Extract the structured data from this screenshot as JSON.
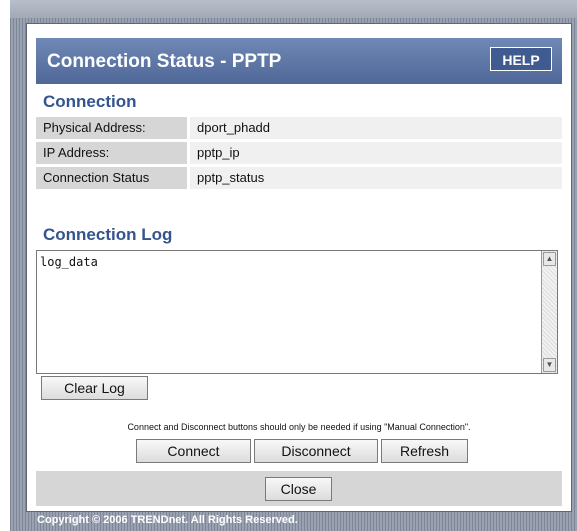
{
  "header": {
    "title": "Connection Status - PPTP",
    "help_label": "HELP"
  },
  "connection": {
    "heading": "Connection",
    "rows": [
      {
        "label": "Physical Address:",
        "value": "dport_phadd"
      },
      {
        "label": "IP Address:",
        "value": "pptp_ip"
      },
      {
        "label": "Connection Status",
        "value": "pptp_status"
      }
    ]
  },
  "log": {
    "heading": "Connection Log",
    "content": "log_data",
    "clear_label": "Clear Log"
  },
  "actions": {
    "note": "Connect and Disconnect buttons should only be needed if using \"Manual Connection\".",
    "connect_label": "Connect",
    "disconnect_label": "Disconnect",
    "refresh_label": "Refresh"
  },
  "footer": {
    "close_label": "Close",
    "copyright": "Copyright © 2006 TRENDnet. All Rights Reserved."
  },
  "icons": {
    "scroll_up": "scroll-up-arrow-icon",
    "scroll_down": "scroll-down-arrow-icon"
  },
  "colors": {
    "title_bar": "#5a73a3",
    "section_heading": "#33548f",
    "label_cell": "#d6d6d6",
    "value_cell": "#f0f0f0"
  }
}
